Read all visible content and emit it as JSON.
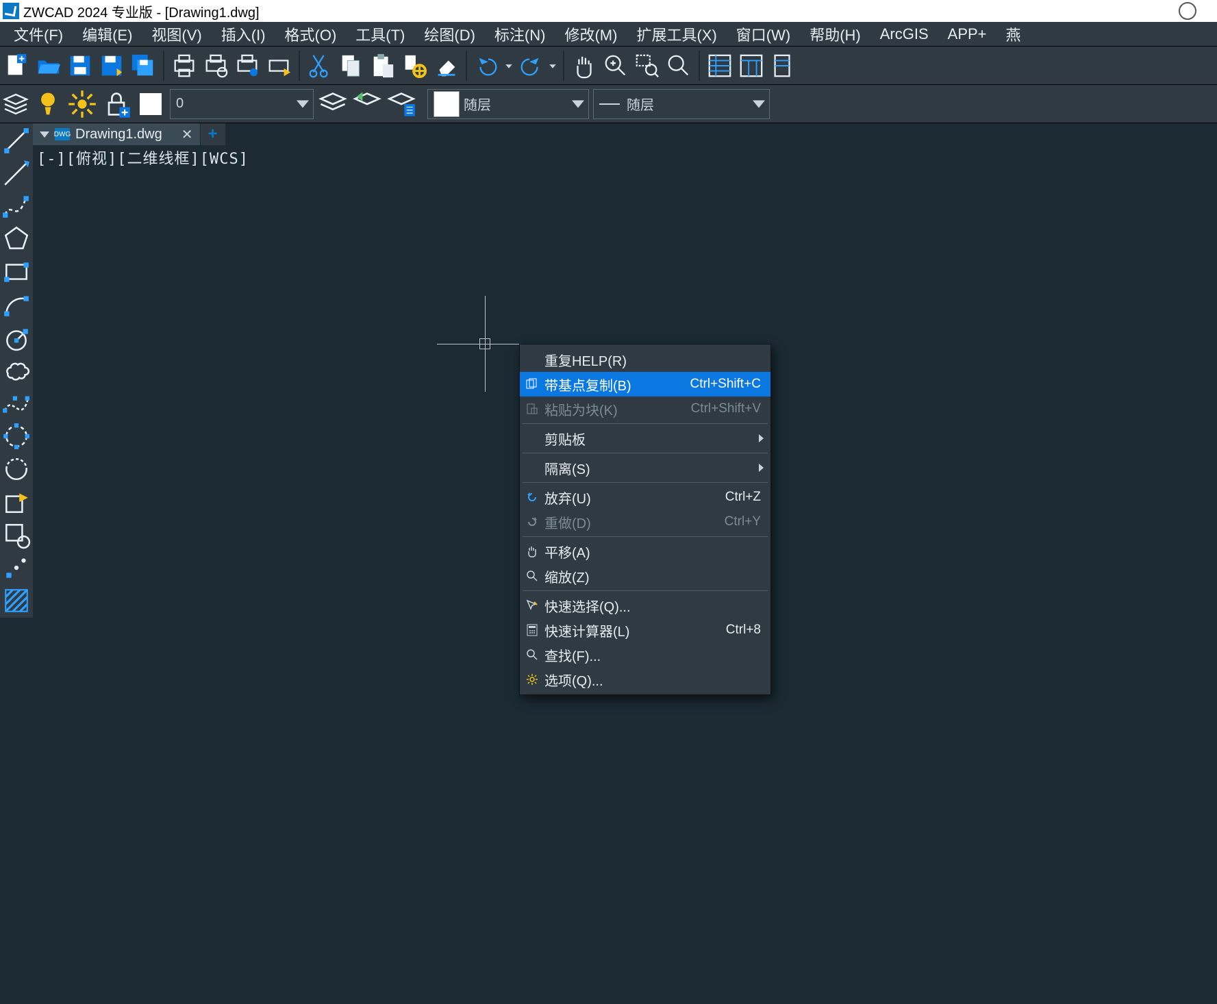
{
  "titlebar": {
    "text": "ZWCAD 2024 专业版 - [Drawing1.dwg]"
  },
  "menubar": {
    "items": [
      {
        "label": "文件(F)"
      },
      {
        "label": "编辑(E)"
      },
      {
        "label": "视图(V)"
      },
      {
        "label": "插入(I)"
      },
      {
        "label": "格式(O)"
      },
      {
        "label": "工具(T)"
      },
      {
        "label": "绘图(D)"
      },
      {
        "label": "标注(N)"
      },
      {
        "label": "修改(M)"
      },
      {
        "label": "扩展工具(X)"
      },
      {
        "label": "窗口(W)"
      },
      {
        "label": "帮助(H)"
      },
      {
        "label": "ArcGIS"
      },
      {
        "label": "APP+"
      },
      {
        "label": "燕"
      }
    ]
  },
  "layerbar": {
    "current_layer": "0",
    "color_label": "随层",
    "linetype_label": "随层"
  },
  "doctab": {
    "name": "Drawing1.dwg",
    "icon_text": "DWG",
    "close": "✕",
    "add": "+"
  },
  "viewport": {
    "header": "[-][俯视][二维线框][WCS]"
  },
  "context_menu": {
    "items": [
      {
        "label": "重复HELP(R)",
        "icon": "",
        "sc": "",
        "sub": false,
        "dis": false,
        "sel": false
      },
      {
        "label": "带基点复制(B)",
        "icon": "copybase",
        "sc": "Ctrl+Shift+C",
        "sub": false,
        "dis": false,
        "sel": true
      },
      {
        "label": "粘贴为块(K)",
        "icon": "pasteblock",
        "sc": "Ctrl+Shift+V",
        "sub": false,
        "dis": true,
        "sel": false
      },
      {
        "sep": true
      },
      {
        "label": "剪贴板",
        "icon": "",
        "sc": "",
        "sub": true,
        "dis": false,
        "sel": false
      },
      {
        "sep": true
      },
      {
        "label": "隔离(S)",
        "icon": "",
        "sc": "",
        "sub": true,
        "dis": false,
        "sel": false
      },
      {
        "sep": true
      },
      {
        "label": "放弃(U)",
        "icon": "undo",
        "sc": "Ctrl+Z",
        "sub": false,
        "dis": false,
        "sel": false
      },
      {
        "label": "重做(D)",
        "icon": "redo",
        "sc": "Ctrl+Y",
        "sub": false,
        "dis": true,
        "sel": false
      },
      {
        "sep": true
      },
      {
        "label": "平移(A)",
        "icon": "pan",
        "sc": "",
        "sub": false,
        "dis": false,
        "sel": false
      },
      {
        "label": "缩放(Z)",
        "icon": "zoom",
        "sc": "",
        "sub": false,
        "dis": false,
        "sel": false
      },
      {
        "sep": true
      },
      {
        "label": "快速选择(Q)...",
        "icon": "qselect",
        "sc": "",
        "sub": false,
        "dis": false,
        "sel": false
      },
      {
        "label": "快速计算器(L)",
        "icon": "calc",
        "sc": "Ctrl+8",
        "sub": false,
        "dis": false,
        "sel": false
      },
      {
        "label": "查找(F)...",
        "icon": "find",
        "sc": "",
        "sub": false,
        "dis": false,
        "sel": false
      },
      {
        "label": "选项(Q)...",
        "icon": "options",
        "sc": "",
        "sub": false,
        "dis": false,
        "sel": false
      }
    ]
  }
}
